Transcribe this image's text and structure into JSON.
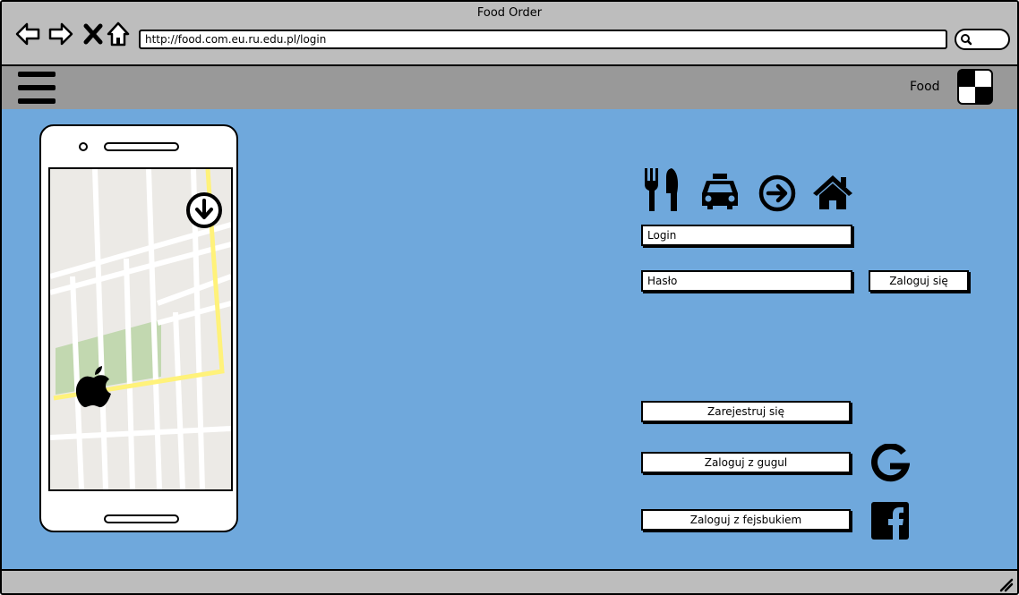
{
  "window": {
    "title": "Food Order"
  },
  "browser": {
    "url": "http://food.com.eu.ru.edu.pl/login",
    "nav_icons": [
      "back-arrow-icon",
      "forward-arrow-icon",
      "close-x-icon",
      "home-outline-icon"
    ]
  },
  "appbar": {
    "app_name": "Food",
    "menu_icon": "hamburger-menu-icon",
    "avatar_icon": "checkered-avatar-icon"
  },
  "header_icons": [
    "fork-knife-icon",
    "taxi-icon",
    "arrow-circle-right-icon",
    "home-icon"
  ],
  "login_form": {
    "login_placeholder": "Login",
    "password_placeholder": "Hasło",
    "submit_label": "Zaloguj się"
  },
  "actions": {
    "register_label": "Zarejestruj się",
    "google_label": "Zaloguj z gugul",
    "facebook_label": "Zaloguj z fejsbukiem"
  },
  "phone_mock": {
    "map_icons": [
      "apple-logo-icon",
      "download-arrow-icon"
    ]
  },
  "colors": {
    "content_bg": "#6fa8dc",
    "chrome": "#bdbdbd",
    "appbar": "#999999",
    "route": "#fff27a",
    "park": "#c2d8b0"
  }
}
